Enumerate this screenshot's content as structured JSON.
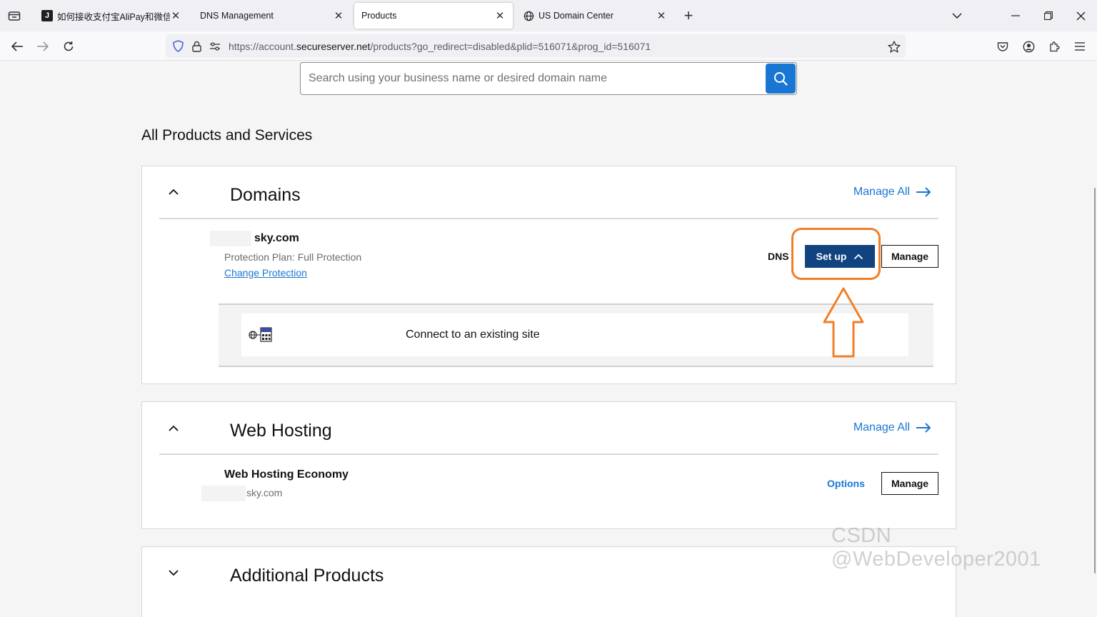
{
  "browser": {
    "tabs": [
      {
        "title": "如何接收支付宝AliPay和微信支付",
        "favicon": "J",
        "active": false
      },
      {
        "title": "DNS Management",
        "active": false
      },
      {
        "title": "Products",
        "active": true
      },
      {
        "title": "US Domain Center",
        "active": false
      }
    ],
    "url_prefix": "https://account.",
    "url_host": "secureserver.net",
    "url_path": "/products?go_redirect=disabled&plid=516071&prog_id=516071"
  },
  "search": {
    "placeholder": "Search using your business name or desired domain name"
  },
  "page_heading": "All Products and Services",
  "domains": {
    "title": "Domains",
    "manage_all": "Manage All",
    "domain_name": "sky.com",
    "protection_plan": "Protection Plan: Full Protection",
    "change_protection": "Change Protection",
    "dns_label": "DNS",
    "setup_label": "Set up",
    "manage_label": "Manage",
    "dropdown_option": "Connect to an existing site"
  },
  "web_hosting": {
    "title": "Web Hosting",
    "manage_all": "Manage All",
    "plan_name": "Web Hosting Economy",
    "domain": "sky.com",
    "options_label": "Options",
    "manage_label": "Manage"
  },
  "additional": {
    "title": "Additional Products"
  },
  "annotation": {
    "highlight_color": "#f07f2a"
  },
  "watermark": "CSDN @WebDeveloper2001",
  "colors": {
    "link_blue": "#1976d2",
    "primary_button": "#10437f",
    "annotation_orange": "#f07f2a"
  }
}
